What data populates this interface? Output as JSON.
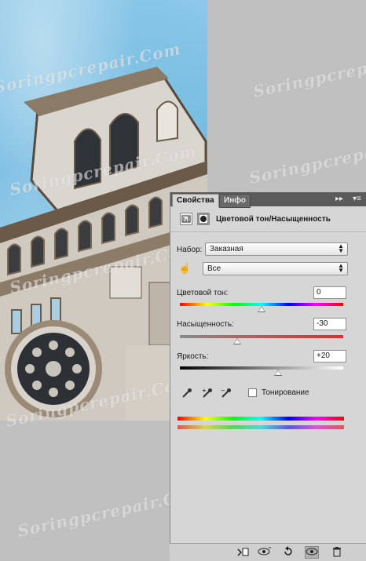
{
  "watermark": "Soringpcrepair.Com",
  "panel": {
    "tabs": [
      {
        "label": "Свойства"
      },
      {
        "label": "Инфо"
      }
    ],
    "title": "Цветовой тон/Насыщенность",
    "preset_label": "Набор:",
    "preset_value": "Заказная",
    "channel_value": "Все",
    "hue": {
      "label": "Цветовой тон:",
      "value": "0",
      "level": 0
    },
    "saturation": {
      "label": "Насыщенность:",
      "value": "-30",
      "level": -30
    },
    "lightness": {
      "label": "Яркость:",
      "value": "+20",
      "level": 20
    },
    "colorize": {
      "label": "Тонирование",
      "checked": false
    }
  },
  "colors": {
    "panel_bg": "#d6d6d6",
    "tabbar_bg": "#5a5a5a",
    "sky": "#6eb6e0"
  }
}
